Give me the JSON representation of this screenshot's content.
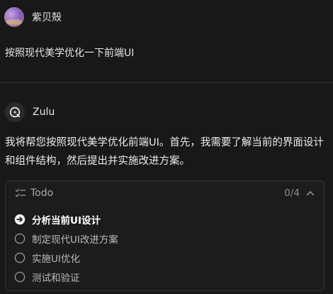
{
  "user": {
    "name": "紫贝殻",
    "message": "按照现代美学优化一下前端UI"
  },
  "agent": {
    "name": "Zulu",
    "message": "我将帮您按照现代美学优化前端UI。首先，我需要了解当前的界面设计和组件结构，然后提出并实施改进方案。"
  },
  "todo": {
    "title": "Todo",
    "count": "0/4",
    "items": [
      {
        "label": "分析当前UI设计",
        "state": "in-progress"
      },
      {
        "label": "制定现代UI改进方案",
        "state": "pending"
      },
      {
        "label": "实施UI优化",
        "state": "pending"
      },
      {
        "label": "测试和验证",
        "state": "pending"
      }
    ]
  },
  "icons": {
    "list": "list-check-icon",
    "collapse": "chevron-up-icon",
    "in_progress": "arrow-circle-icon",
    "pending": "empty-circle-icon"
  },
  "colors": {
    "background": "#181818",
    "text": "#e6e6e6",
    "muted": "#a8a8a8",
    "border": "#333333"
  }
}
